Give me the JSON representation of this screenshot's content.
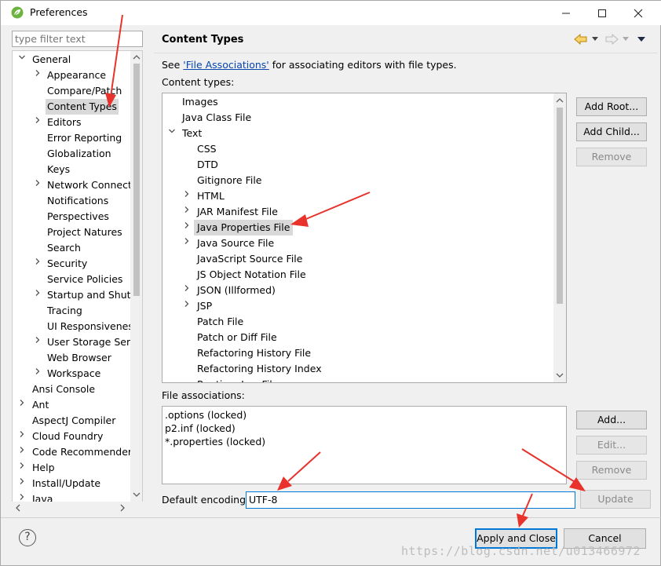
{
  "window": {
    "title": "Preferences",
    "minimize": "—",
    "maximize": "□",
    "close": "✕"
  },
  "filter": {
    "placeholder": "type filter text"
  },
  "tree": {
    "items": [
      {
        "label": "General",
        "twisty": "open"
      },
      {
        "label": "Appearance",
        "twisty": "closed"
      },
      {
        "label": "Compare/Patch",
        "twisty": ""
      },
      {
        "label": "Content Types",
        "twisty": "",
        "selected": true
      },
      {
        "label": "Editors",
        "twisty": "closed"
      },
      {
        "label": "Error Reporting",
        "twisty": ""
      },
      {
        "label": "Globalization",
        "twisty": ""
      },
      {
        "label": "Keys",
        "twisty": ""
      },
      {
        "label": "Network Connections",
        "twisty": "closed"
      },
      {
        "label": "Notifications",
        "twisty": ""
      },
      {
        "label": "Perspectives",
        "twisty": ""
      },
      {
        "label": "Project Natures",
        "twisty": ""
      },
      {
        "label": "Search",
        "twisty": ""
      },
      {
        "label": "Security",
        "twisty": "closed"
      },
      {
        "label": "Service Policies",
        "twisty": ""
      },
      {
        "label": "Startup and Shutdown",
        "twisty": "closed"
      },
      {
        "label": "Tracing",
        "twisty": ""
      },
      {
        "label": "UI Responsiveness",
        "twisty": ""
      },
      {
        "label": "User Storage Service",
        "twisty": "closed"
      },
      {
        "label": "Web Browser",
        "twisty": ""
      },
      {
        "label": "Workspace",
        "twisty": "closed"
      },
      {
        "label": "Ansi Console",
        "twisty": ""
      },
      {
        "label": "Ant",
        "twisty": "closed"
      },
      {
        "label": "AspectJ Compiler",
        "twisty": ""
      },
      {
        "label": "Cloud Foundry",
        "twisty": "closed"
      },
      {
        "label": "Code Recommenders",
        "twisty": "closed"
      },
      {
        "label": "Help",
        "twisty": "closed"
      },
      {
        "label": "Install/Update",
        "twisty": "closed"
      },
      {
        "label": "Java",
        "twisty": "closed"
      }
    ]
  },
  "page": {
    "title": "Content Types",
    "see_prefix": "See ",
    "see_link": "'File Associations'",
    "see_suffix": " for associating editors with file types.",
    "content_types_label": "Content types:",
    "file_assoc_label": "File associations:",
    "encoding_label": "Default encoding:",
    "encoding_value": "UTF-8"
  },
  "content_types": [
    {
      "label": "Images",
      "twisty": ""
    },
    {
      "label": "Java Class File",
      "twisty": ""
    },
    {
      "label": "Text",
      "twisty": "open"
    },
    {
      "label": "CSS",
      "twisty": ""
    },
    {
      "label": "DTD",
      "twisty": ""
    },
    {
      "label": "Gitignore File",
      "twisty": ""
    },
    {
      "label": "HTML",
      "twisty": "closed"
    },
    {
      "label": "JAR Manifest File",
      "twisty": "closed"
    },
    {
      "label": "Java Properties File",
      "twisty": "closed",
      "selected": true
    },
    {
      "label": "Java Source File",
      "twisty": "closed"
    },
    {
      "label": "JavaScript Source File",
      "twisty": ""
    },
    {
      "label": "JS Object Notation File",
      "twisty": ""
    },
    {
      "label": "JSON (Illformed)",
      "twisty": "closed"
    },
    {
      "label": "JSP",
      "twisty": "closed"
    },
    {
      "label": "Patch File",
      "twisty": ""
    },
    {
      "label": "Patch or Diff File",
      "twisty": ""
    },
    {
      "label": "Refactoring History File",
      "twisty": ""
    },
    {
      "label": "Refactoring History Index",
      "twisty": ""
    },
    {
      "label": "Runtime Log File",
      "twisty": ""
    }
  ],
  "file_associations": [
    ".options (locked)",
    "p2.inf (locked)",
    "*.properties (locked)"
  ],
  "buttons": {
    "add_root": "Add Root...",
    "add_child": "Add Child...",
    "remove_type": "Remove",
    "add": "Add...",
    "edit": "Edit...",
    "remove_assoc": "Remove",
    "update": "Update",
    "apply_close": "Apply and Close",
    "cancel": "Cancel"
  },
  "help": {
    "label": "?"
  },
  "watermark": "https://blog.csdn.net/u013466972",
  "colors": {
    "arrow": "#e8322b",
    "accent": "#0078d7",
    "link": "#0645ad"
  }
}
